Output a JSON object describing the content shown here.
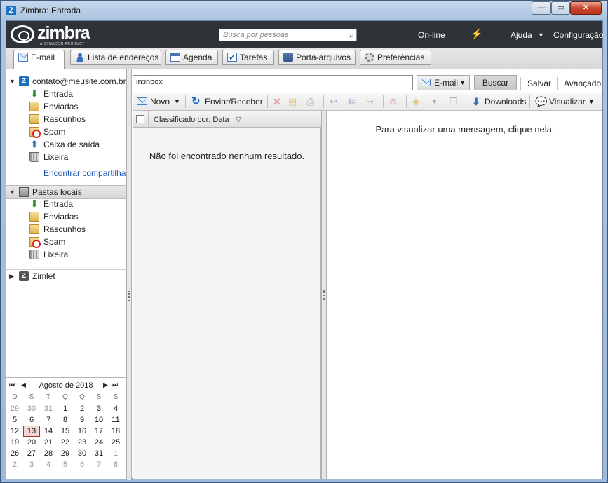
{
  "window": {
    "title": "Zimbra: Entrada",
    "app_icon": "Z"
  },
  "header": {
    "logo_text": "zimbra",
    "logo_sub": "A SYNACOR PRODUCT",
    "search_placeholder": "Busca por pessoas",
    "status": "On-line",
    "help": "Ajuda",
    "settings": "Configuração"
  },
  "tabs": [
    {
      "label": "E-mail",
      "icon": "mail-icon"
    },
    {
      "label": "Lista de endereços",
      "icon": "contacts-icon"
    },
    {
      "label": "Agenda",
      "icon": "calendar-icon"
    },
    {
      "label": "Tarefas",
      "icon": "tasks-icon"
    },
    {
      "label": "Porta-arquivos",
      "icon": "briefcase-icon"
    },
    {
      "label": "Preferências",
      "icon": "gear-icon"
    }
  ],
  "sidebar": {
    "account": "contato@meusite.com.br",
    "account_folders": [
      "Entrada",
      "Enviadas",
      "Rascunhos",
      "Spam",
      "Caixa de saída",
      "Lixeira"
    ],
    "find_shares": "Encontrar compartilham",
    "local_title": "Pastas locais",
    "local_folders": [
      "Entrada",
      "Enviadas",
      "Rascunhos",
      "Spam",
      "Lixeira"
    ],
    "zimlet": "Zimlet"
  },
  "calendar": {
    "month": "Agosto de 2018",
    "weekdays": [
      "D",
      "S",
      "T",
      "Q",
      "Q",
      "S",
      "S"
    ],
    "weeks": [
      [
        "29",
        "30",
        "31",
        "1",
        "2",
        "3",
        "4"
      ],
      [
        "5",
        "6",
        "7",
        "8",
        "9",
        "10",
        "11"
      ],
      [
        "12",
        "13",
        "14",
        "15",
        "16",
        "17",
        "18"
      ],
      [
        "19",
        "20",
        "21",
        "22",
        "23",
        "24",
        "25"
      ],
      [
        "26",
        "27",
        "28",
        "29",
        "30",
        "31",
        "1"
      ],
      [
        "2",
        "3",
        "4",
        "5",
        "6",
        "7",
        "8"
      ]
    ],
    "today": "13"
  },
  "search": {
    "query": "in:inbox",
    "type": "E-mail",
    "search_btn": "Buscar",
    "save_btn": "Salvar",
    "advanced": "Avançado"
  },
  "toolbar": {
    "new": "Novo",
    "send_receive": "Enviar/Receber",
    "downloads": "Downloads",
    "view": "Visualizar"
  },
  "list": {
    "sort_label": "Classificado por: Data",
    "empty": "Não foi encontrado nenhum resultado."
  },
  "reading": {
    "hint": "Para visualizar uma mensagem, clique nela."
  }
}
